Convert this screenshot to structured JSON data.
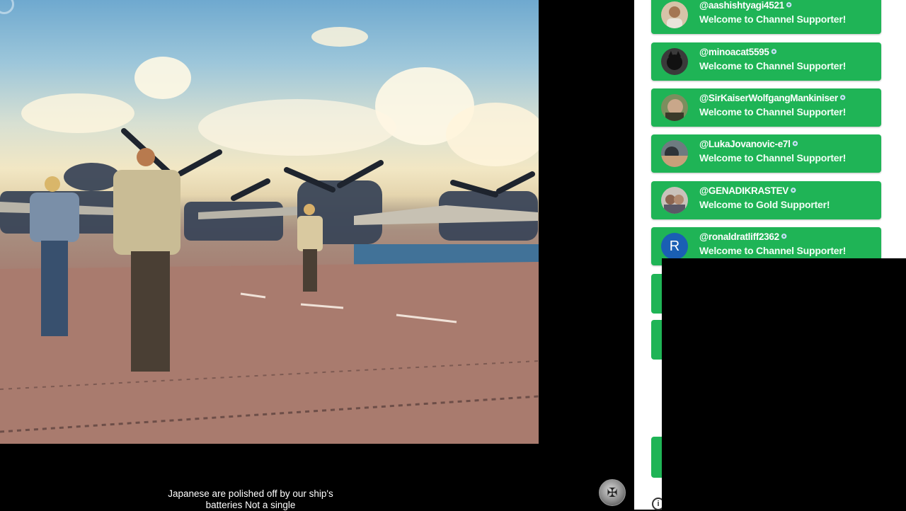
{
  "video": {
    "subtitle": "Japanese are polished off by our ship's batteries Not a single"
  },
  "chat": {
    "items": [
      {
        "author": "@aashishtyagi4521",
        "message": "Welcome to Channel Supporter!",
        "avatar": "person-avatar"
      },
      {
        "author": "@minoacat5595",
        "message": "Welcome to Channel Supporter!",
        "avatar": "cat-avatar"
      },
      {
        "author": "@SirKaiserWolfgangMankiniser",
        "message": "Welcome to Channel Supporter!",
        "avatar": "person-avatar"
      },
      {
        "author": "@LukaJovanovic-e7l",
        "message": "Welcome to Channel Supporter!",
        "avatar": "person-avatar"
      },
      {
        "author": "@GENADIKRASTEV",
        "message": "Welcome to Gold Supporter!",
        "avatar": "person-avatar"
      },
      {
        "author": "@ronaldratliff2362",
        "message": "Welcome to Channel Supporter!",
        "avatar_letter": "R"
      }
    ],
    "card_color": "#1fb456"
  },
  "icons": {
    "member_badge": "member-badge-icon",
    "info": "info-icon",
    "watermark": "channel-watermark-icon"
  }
}
